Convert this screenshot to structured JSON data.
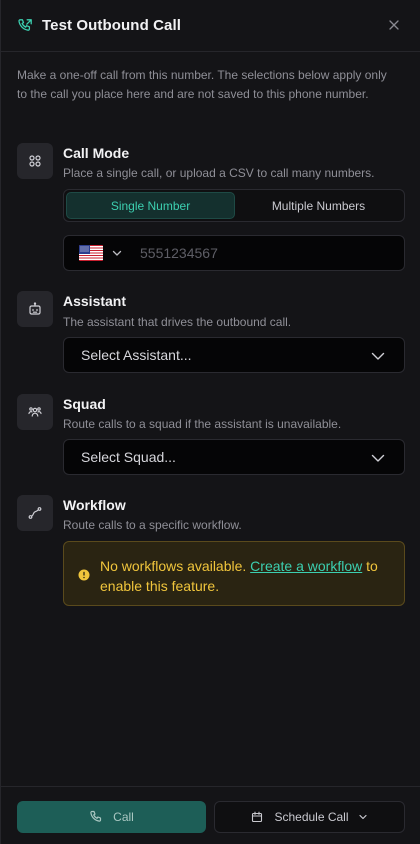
{
  "header": {
    "title": "Test Outbound Call",
    "icon": "phone-outgoing-icon",
    "close_icon": "close-icon"
  },
  "intro": "Make a one-off call from this number. The selections below apply only to the call you place here and are not saved to this phone number.",
  "call_mode": {
    "title": "Call Mode",
    "description": "Place a single call, or upload a CSV to call many numbers.",
    "icon": "grid-icon",
    "options": [
      {
        "label": "Single Number",
        "active": true
      },
      {
        "label": "Multiple Numbers",
        "active": false
      }
    ],
    "phone_placeholder": "5551234567",
    "phone_value": "",
    "country_icon": "us-flag-icon"
  },
  "assistant": {
    "title": "Assistant",
    "description": "The assistant that drives the outbound call.",
    "icon": "bot-icon",
    "selected": "Select Assistant..."
  },
  "squad": {
    "title": "Squad",
    "description": "Route calls to a squad if the assistant is unavailable.",
    "icon": "users-icon",
    "selected": "Select Squad..."
  },
  "workflow": {
    "title": "Workflow",
    "description": "Route calls to a specific workflow.",
    "icon": "workflow-icon",
    "alert_text": "No workflows available. ",
    "alert_link": "Create a workflow",
    "alert_suffix": " to enable this feature.",
    "alert_icon": "warning-circle-icon"
  },
  "footer": {
    "call_label": "Call",
    "schedule_label": "Schedule Call"
  },
  "colors": {
    "accent": "#3ccfb0",
    "warning": "#f0c53c",
    "background": "#141417",
    "call_button": "#1d5e57"
  }
}
